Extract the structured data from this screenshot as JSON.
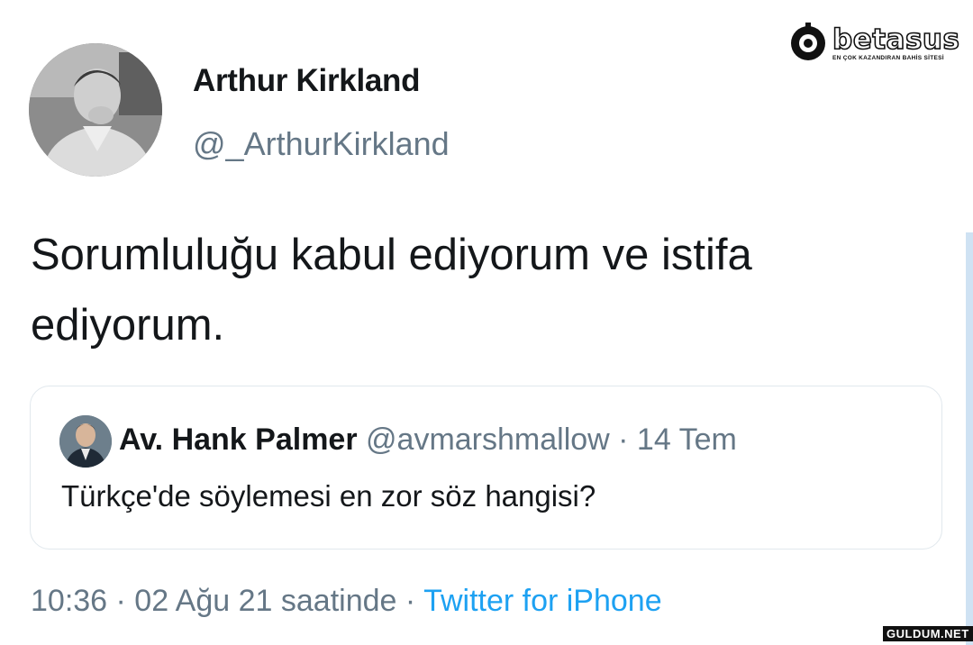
{
  "tweet": {
    "author_name": "Arthur Kirkland",
    "author_handle": "@_ArthurKirkland",
    "avatar_icon": "person-photo-icon",
    "text": "Sorumluluğu kabul ediyorum ve istifa ediyorum.",
    "timestamp": "10:36 · 02 Ağu 21 saatinde",
    "separator": " · ",
    "source": "Twitter for iPhone"
  },
  "quoted": {
    "author_name": "Av. Hank Palmer",
    "meta": "@avmarshmallow · 14 Tem",
    "text": "Türkçe'de söylemesi en zor söz hangisi?",
    "avatar_icon": "person-photo-icon"
  },
  "brand": {
    "name": "betasus",
    "tagline": "EN ÇOK KAZANDIRAN BAHİS SİTESİ",
    "icon": "betasus-logo-icon"
  },
  "watermark": "GULDUM.NET",
  "colors": {
    "text": "#14171a",
    "secondary": "#657786",
    "link": "#1da1f2",
    "border": "#e1e8ed"
  }
}
